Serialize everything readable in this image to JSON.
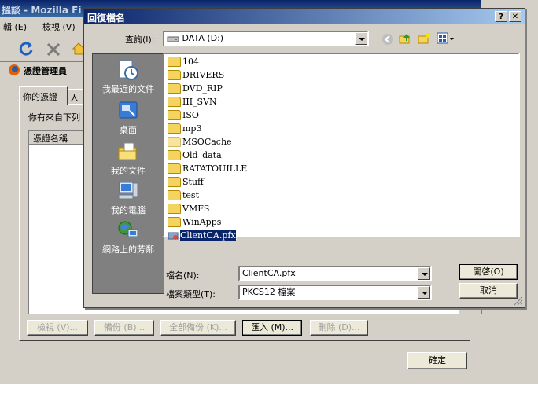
{
  "bg_window": {
    "title": "搵談 - Mozilla Fi",
    "menu": [
      "輯 (E)",
      "檢視 (V)"
    ],
    "subtitle": "憑證管理員",
    "tabs": [
      "你的憑證",
      "人"
    ],
    "intro_text": "你有來自下列",
    "list_header": "憑證名稱",
    "buttons": {
      "view": "檢視 (V)...",
      "backup": "備份 (B)...",
      "backup_all": "全部備份 (K)...",
      "import": "匯入 (M)...",
      "delete": "刪除 (D)...",
      "ok": "確定"
    }
  },
  "dialog": {
    "title": "回復檔名",
    "lookin_label": "查詢(I):",
    "lookin_value": "DATA (D:)",
    "places": [
      {
        "label": "我最近的文件",
        "icon": "recent-documents-icon"
      },
      {
        "label": "桌面",
        "icon": "desktop-icon"
      },
      {
        "label": "我的文件",
        "icon": "my-documents-icon"
      },
      {
        "label": "我的電腦",
        "icon": "my-computer-icon"
      },
      {
        "label": "網路上的芳鄰",
        "icon": "network-places-icon"
      }
    ],
    "files": [
      "104",
      "DRIVERS",
      "DVD_RIP",
      "III_SVN",
      "ISO",
      "mp3",
      "MSOCache",
      "Old_data",
      "RATATOUILLE",
      "Stuff",
      "test",
      "VMFS",
      "WinApps",
      "ClientCA.pfx"
    ],
    "selected_file": "ClientCA.pfx",
    "filename_label": "檔名(N):",
    "filename_value": "ClientCA.pfx",
    "filetype_label": "檔案類型(T):",
    "filetype_value": "PKCS12 檔案",
    "open_button": "開啓(O)",
    "cancel_button": "取消"
  }
}
